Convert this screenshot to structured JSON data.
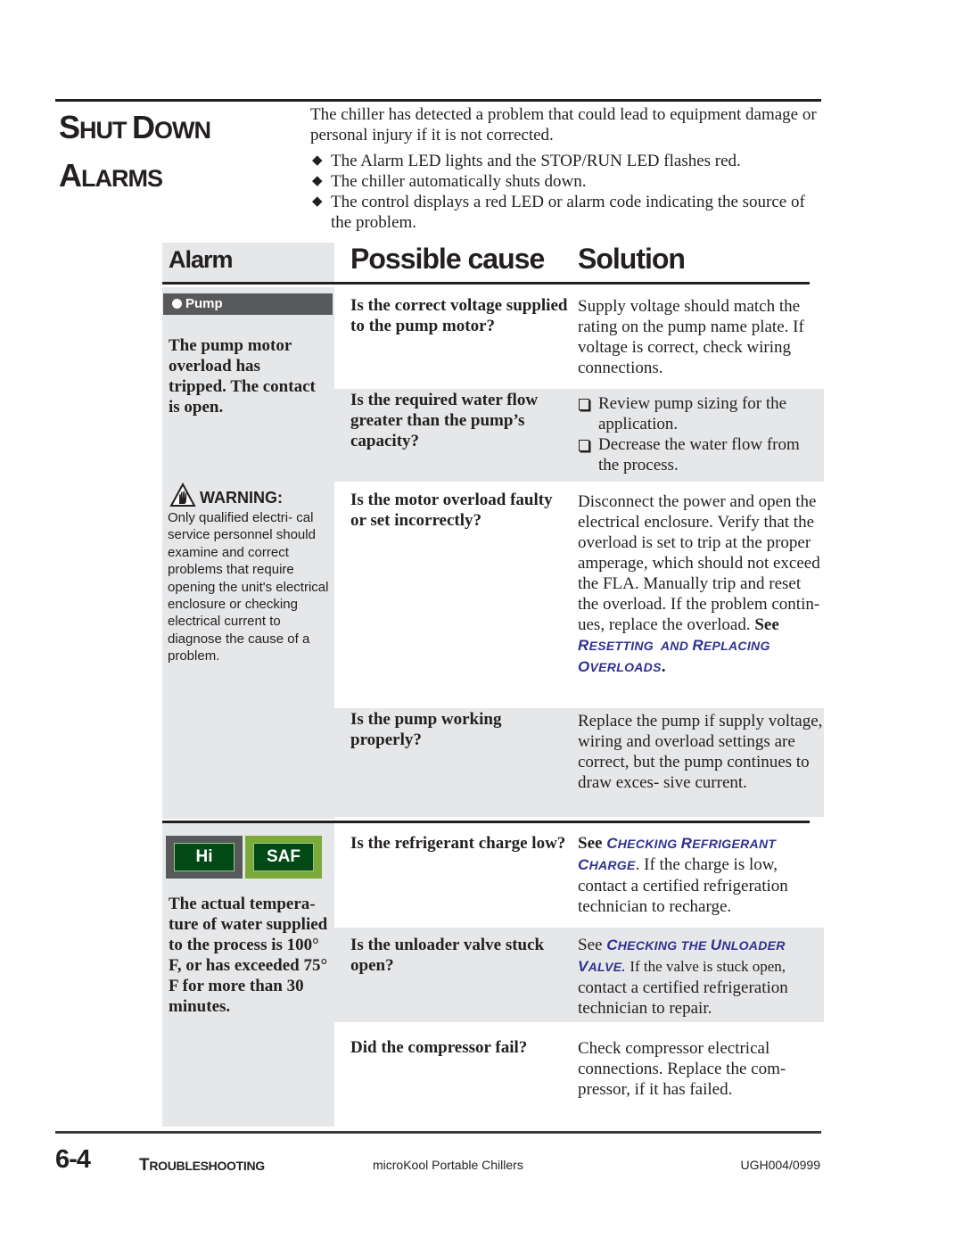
{
  "section": {
    "title_line1_initial": "S",
    "title_line1_rest": "HUT ",
    "title_line1_initial2": "D",
    "title_line1_rest2": "OWN",
    "title_line2_initial": "A",
    "title_line2_rest": "LARMS",
    "intro": "The chiller has detected a problem that could lead to equipment damage or personal injury if it is not corrected.",
    "bullets": [
      "The Alarm LED lights and the STOP/RUN LED flashes red.",
      "The chiller automatically shuts down.",
      "The control displays a red LED or alarm code indicating the source of the problem."
    ]
  },
  "table": {
    "headers": {
      "alarm": "Alarm",
      "cause": "Possible cause",
      "solution": "Solution"
    },
    "groups": [
      {
        "alarm_label": "Pump",
        "alarm_description": "The pump motor overload has tripped. The contact is open.",
        "warning": {
          "title": "WARNING:",
          "text": "Only qualified electri- cal service personnel should examine and correct problems that require opening the unit's electrical enclosure or checking electrical current to diagnose the cause of a problem."
        },
        "rows": [
          {
            "cause": "Is the correct voltage supplied to the pump motor?",
            "solution": "Supply voltage should match the rating on the pump name plate. If voltage is correct, check wiring connections."
          },
          {
            "cause": "Is the required water flow greater than the pump’s capacity?",
            "solution_items": [
              "Review pump sizing for the application.",
              "Decrease the water flow from the process."
            ]
          },
          {
            "cause": "Is the motor overload faulty or set incorrectly?",
            "solution": "Disconnect the power and open the electrical enclosure. Verify that the overload is set to trip at the proper amperage, which should not exceed the FLA. Manually trip and reset the overload. If the problem contin- ues, replace the overload.",
            "solution_see": "See",
            "link": {
              "w1_cap": "R",
              "w1_rest": "ESETTING",
              "w2": "AND",
              "w3_cap": "R",
              "w3_rest": "EPLACING",
              "w4_cap": "O",
              "w4_rest": "VERLOADS"
            },
            "link_suffix": "."
          },
          {
            "cause": "Is the pump working properly?",
            "solution": "Replace the pump if supply voltage, wiring and overload settings are correct, but the pump continues to draw exces- sive current."
          }
        ]
      },
      {
        "led_labels": [
          "Hi",
          "SAF"
        ],
        "led_colors": {
          "hi_frame": "#58595b",
          "saf_frame": "#7aab3a",
          "led_fill": "#024a15"
        },
        "alarm_description": "The actual tempera- ture of water supplied to the process is 100° F, or has exceeded 75° F for more than 30 minutes.",
        "rows": [
          {
            "cause": "Is the refrigerant charge low?",
            "solution_see": "See",
            "link": {
              "w1_cap": "C",
              "w1_rest": "HECKING",
              "w2_cap": "R",
              "w2_rest": "EFRIGERANT",
              "w3_cap": "C",
              "w3_rest": "HARGE"
            },
            "solution": ".  If the charge is low, contact a certified refrigeration technician to recharge."
          },
          {
            "cause": "Is the unloader valve stuck open?",
            "solution_see": "See",
            "link": {
              "w1_cap": "C",
              "w1_rest": "HECKING",
              "w2": "THE",
              "w3_cap": "U",
              "w3_rest": "NLOADER",
              "w4_cap": "V",
              "w4_rest": "ALVE."
            },
            "solution_small": "If the valve is stuck open,",
            "solution": "contact a certified refrigeration technician to repair."
          },
          {
            "cause": "Did the compressor fail?",
            "solution": "Check compressor electrical connections. Replace the com- pressor, if it has failed."
          }
        ]
      }
    ]
  },
  "footer": {
    "page_number": "6-4",
    "section_initial": "T",
    "section_rest": "ROUBLESHOOTING",
    "product": "microKool Portable Chillers",
    "doc_code": "UGH004/0999"
  },
  "colors": {
    "link_blue": "#2e3192",
    "panel_gray": "#e6e7e8",
    "dark_bar": "#58595b"
  }
}
